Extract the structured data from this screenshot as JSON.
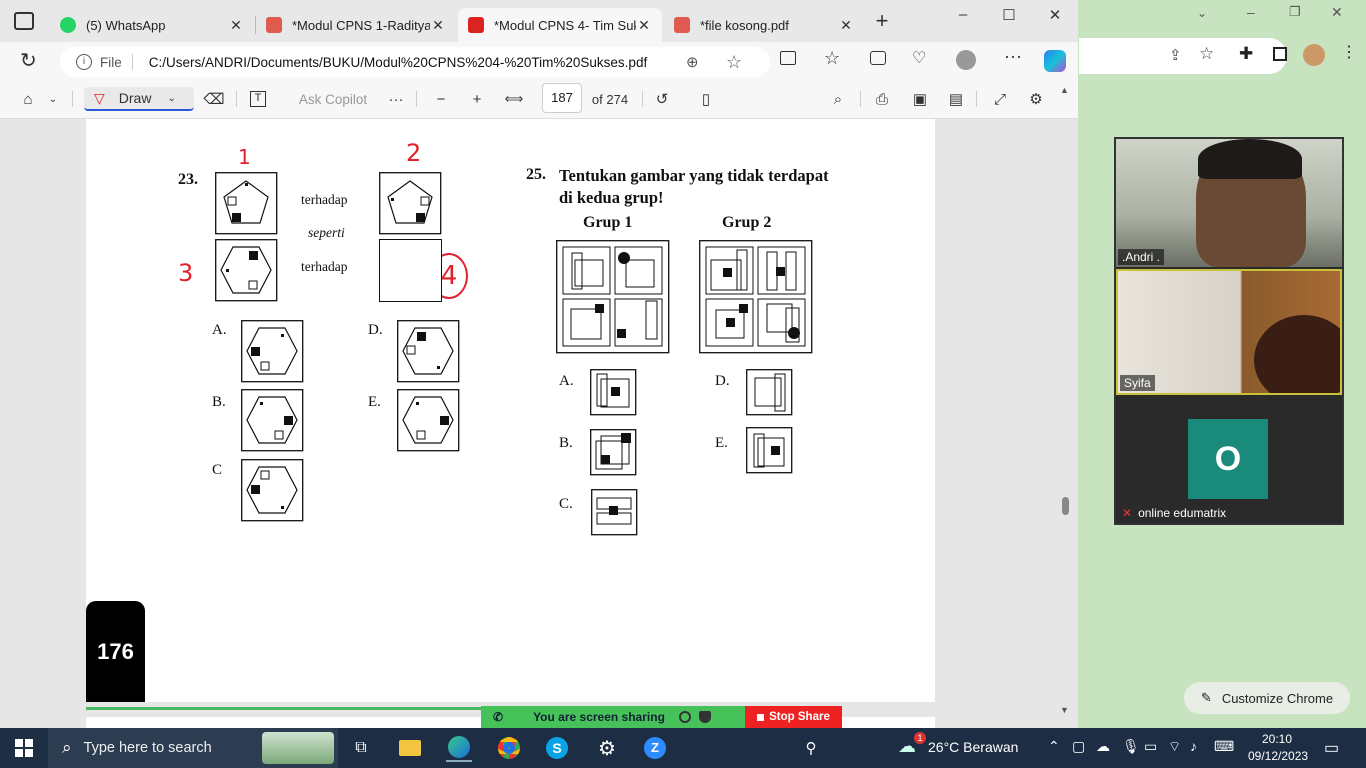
{
  "tabs": [
    {
      "title": "(5) WhatsApp",
      "icon": "whatsapp-icon",
      "color": "#25d366"
    },
    {
      "title": "*Modul CPNS 1-Raditya P",
      "icon": "pdf-icon",
      "color": "#e05a4f"
    },
    {
      "title": "*Modul CPNS 4- Tim Suks",
      "icon": "pdf-icon",
      "color": "#d22"
    },
    {
      "title": "*file kosong.pdf",
      "icon": "pdf-icon",
      "color": "#e05a4f"
    }
  ],
  "address": {
    "scheme": "File",
    "url": "C:/Users/ANDRI/Documents/BUKU/Modul%20CPNS%204-%20Tim%20Sukses.pdf"
  },
  "pdf_toolbar": {
    "draw": "Draw",
    "ask_copilot": "Ask Copilot",
    "page": "187",
    "of": "of 274"
  },
  "page_content": {
    "q23": "23.",
    "terhadap1": "terhadap",
    "seperti": "seperti",
    "terhadap2": "terhadap",
    "opts23": [
      "A.",
      "D.",
      "B.",
      "E.",
      "C"
    ],
    "hand": [
      "1",
      "2",
      "3",
      "4"
    ],
    "q25": "25.",
    "q25_text1": "Tentukan gambar yang tidak terdapat",
    "q25_text2": "di kedua grup!",
    "grup1": "Grup 1",
    "grup2": "Grup 2",
    "opts25": [
      "A.",
      "D.",
      "B.",
      "E.",
      "C."
    ],
    "page_number": "176"
  },
  "screen_share": {
    "text": "You are screen sharing",
    "stop": "Stop Share"
  },
  "meeting": {
    "participants": [
      ".Andri .",
      "Syifa",
      "online edumatrix"
    ],
    "avatar_letter": "O",
    "avatar_color": "#1a8a7a"
  },
  "customize": "Customize Chrome",
  "taskbar": {
    "search": "Type here to search",
    "weather": "26°C  Berawan",
    "time": "20:10",
    "date": "09/12/2023",
    "weather_badge": "1"
  }
}
